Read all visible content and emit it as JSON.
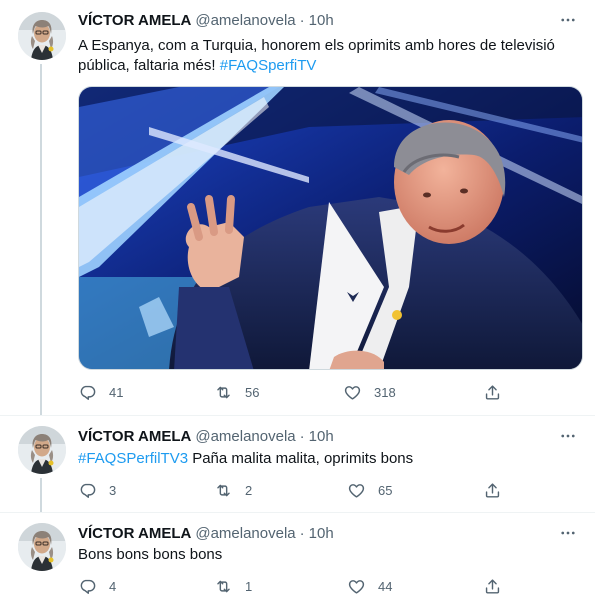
{
  "tweets": [
    {
      "name": "VÍCTOR AMELA",
      "handle": "@amelanovela",
      "separator": "·",
      "time": "10h",
      "text_line1": "A Espanya, com a Turquia, honorem els oprimits amb hores de televisió",
      "text_line2_prefix": "pública, faltaria més! ",
      "hashtag": "#FAQSperfiTV",
      "image_alt": "TV studio scene: man in dark suit gesturing with hand, blue lit set behind",
      "replies": "41",
      "retweets": "56",
      "likes": "318"
    },
    {
      "name": "VÍCTOR AMELA",
      "handle": "@amelanovela",
      "separator": "·",
      "time": "10h",
      "hashtag": "#FAQSPerfilTV3",
      "text_suffix": " Paña malita malita, oprimits bons",
      "replies": "3",
      "retweets": "2",
      "likes": "65"
    },
    {
      "name": "VÍCTOR AMELA",
      "handle": "@amelanovela",
      "separator": "·",
      "time": "10h",
      "text": "Bons bons bons bons",
      "replies": "4",
      "retweets": "1",
      "likes": "44"
    }
  ],
  "icons": {
    "reply": "reply-icon",
    "retweet": "retweet-icon",
    "like": "heart-icon",
    "share": "share-icon",
    "more": "more-options-icon"
  },
  "colors": {
    "link": "#1d9bf0",
    "secondary": "#536471",
    "thread_line": "#cfd9de"
  }
}
